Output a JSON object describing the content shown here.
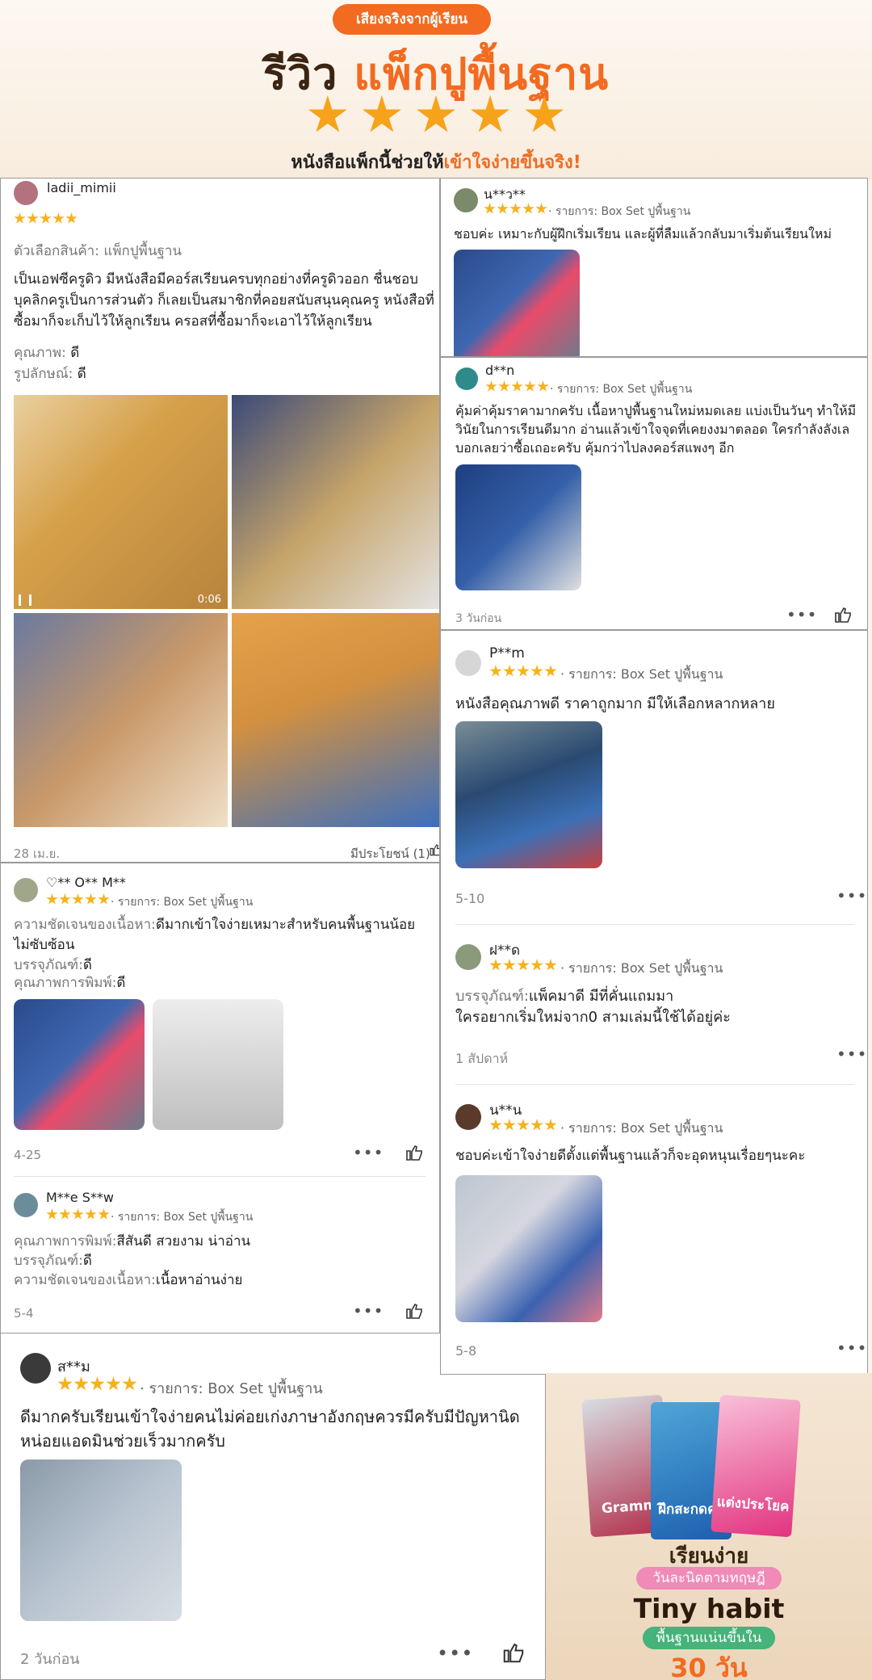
{
  "header": {
    "badge": "เสียงจริงจากผู้เรียน",
    "title_part1": "รีวิว",
    "title_part2": "แพ็กปูพื้นฐาน",
    "subtitle_part1": "หนังสือแพ็กนี้ช่วยให้",
    "subtitle_part2": "เข้าใจง่ายขึ้นจริง!",
    "star_color": "#f7a21b",
    "accent_color": "#f26b21"
  },
  "review1": {
    "user": "ladii_mimii",
    "variant": "ตัวเลือกสินค้า: แพ็กปูพื้นฐาน",
    "body": "เป็นเอฟซีครูดิว มีหนังสือมีคอร์สเรียนครบทุกอย่างที่ครูดิวออก ชื่นชอบบุคลิกครูเป็นการส่วนตัว ก็เลยเป็นสมาชิกที่คอยสนับสนุนคุณครู หนังสือที่ซื้อมาก็จะเก็บไว้ให้ลูกเรียน ครอสที่ซื้อมาก็จะเอาไว้ให้ลูกเรียน",
    "quality_label": "คุณภาพ:",
    "quality_value": "ดี",
    "look_label": "รูปลักษณ์:",
    "look_value": "ดี",
    "video_duration": "0:06",
    "date": "28 เม.ย.",
    "helpful": "มีประโยชน์ (1)"
  },
  "review2": {
    "user": "♡** O** M**",
    "meta": "· รายการ: Box Set ปูพื้นฐาน",
    "l1_label": "ความชัดเจนของเนื้อหา:",
    "l1_value": "ดีมากเข้าใจง่ายเหมาะสำหรับคนพื้นฐานน้อย ไม่ซับซ้อน",
    "l2_label": "บรรจุภัณฑ์:",
    "l2_value": "ดี",
    "l3_label": "คุณภาพการพิมพ์:",
    "l3_value": "ดี",
    "date": "4-25",
    "more": "•••"
  },
  "review3": {
    "user": "M**e S**w",
    "meta": "· รายการ: Box Set ปูพื้นฐาน",
    "l1_label": "คุณภาพการพิมพ์:",
    "l1_value": "สีสันดี สวยงาม น่าอ่าน",
    "l2_label": "บรรจุภัณฑ์:",
    "l2_value": "ดี",
    "l3_label": "ความชัดเจนของเนื้อหา:",
    "l3_value": "เนื้อหาอ่านง่าย",
    "date": "5-4",
    "more": "•••"
  },
  "review4": {
    "user": "ส**ม",
    "meta": "· รายการ: Box Set ปูพื้นฐาน",
    "body": "ดีมากครับเรียนเข้าใจง่ายคนไม่ค่อยเก่งภาษาอังกฤษควรมีครับมีปัญหานิดหน่อยแอดมินช่วยเร็วมากครับ",
    "date": "2 วันก่อน",
    "more": "•••"
  },
  "review5": {
    "user": "น**ว**",
    "meta": "· รายการ: Box Set ปูพื้นฐาน",
    "body": "ชอบค่ะ เหมาะกับผู้ฝึกเริ่มเรียน และผู้ที่ลืมแล้วกลับมาเริ่มต้นเรียนใหม่"
  },
  "review6": {
    "user": "d**n",
    "meta": "· รายการ: Box Set ปูพื้นฐาน",
    "body": "คุ้มค่าคุ้มราคามากครับ เนื้อหาปูพื้นฐานใหม่หมดเลย แบ่งเป็นวันๆ ทำให้มีวินัยในการเรียนดีมาก อ่านแล้วเข้าใจจุดที่เคยงงมาตลอด ใครกำลังลังเลบอกเลยว่าซื้อเถอะครับ คุ้มกว่าไปลงคอร์สแพงๆ อีก",
    "date": "3 วันก่อน",
    "more": "•••"
  },
  "review7": {
    "user": "P**m",
    "meta": "· รายการ: Box Set ปูพื้นฐาน",
    "body": "หนังสือคุณภาพดี ราคาถูกมาก มีให้เลือกหลากหลาย",
    "date": "5-10",
    "more": "•••"
  },
  "review8": {
    "user": "ฝ**ด",
    "meta": "· รายการ: Box Set ปูพื้นฐาน",
    "l1_label": "บรรจุภัณฑ์:",
    "l1_value": "แพ็คมาดี มีที่คั่นแถมมา",
    "l2": "ใครอยากเริ่มใหม่จาก0 สามเล่มนี้ใช้ได้อยู่ค่ะ",
    "date": "1 สัปดาห์",
    "more": "•••"
  },
  "review9": {
    "user": "น**น",
    "meta": "· รายการ: Box Set ปูพื้นฐาน",
    "body": "ชอบค่ะเข้าใจง่ายดีตั้งแต่พื้นฐานแล้วก็จะอุดหนุนเรื่อยๆนะคะ",
    "date": "5-8",
    "more": "•••"
  },
  "promo": {
    "book1": "Gramm",
    "book2": "ฝึกสะกดคำ",
    "book3": "แต่งประโยค",
    "line1": "เรียนง่าย",
    "line2": "วันละนิดตามทฤษฎี",
    "line3": "Tiny habit",
    "line4": "พื้นฐานแน่นขึ้นใน",
    "line5": "30 วัน"
  }
}
